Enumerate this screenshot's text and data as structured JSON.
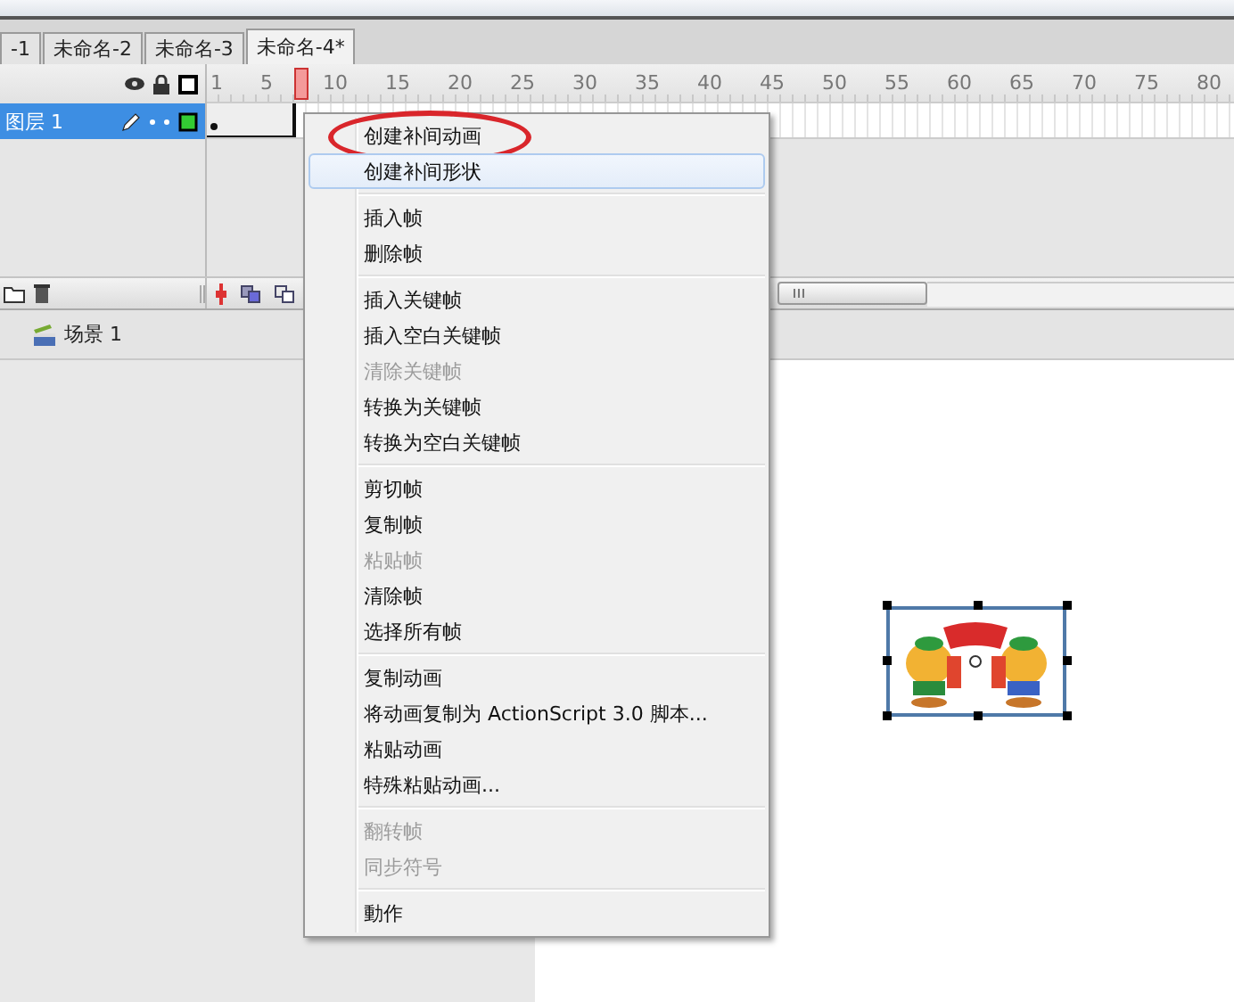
{
  "document_tabs": [
    {
      "label": "-1",
      "selected": false
    },
    {
      "label": "未命名-2",
      "selected": false
    },
    {
      "label": "未命名-3",
      "selected": false
    },
    {
      "label": "未命名-4*",
      "selected": true
    }
  ],
  "timeline": {
    "ruler_labels": [
      "1",
      "5",
      "10",
      "15",
      "20",
      "25",
      "30",
      "35",
      "40",
      "45",
      "50",
      "55",
      "60",
      "65",
      "70",
      "75",
      "80"
    ],
    "playhead": {
      "level": 0.085
    },
    "layers": [
      {
        "name": "图层 1",
        "selected": true,
        "color": "#33cc33"
      }
    ]
  },
  "scene_bar": {
    "scene": "场景 1"
  },
  "stage": {
    "object": {
      "kind": "picture",
      "selected": true
    }
  },
  "context_menu": {
    "groups": [
      {
        "items": [
          {
            "label": "创建补间动画",
            "disabled": false,
            "highlighted": false,
            "circled": true
          },
          {
            "label": "创建补间形状",
            "disabled": false,
            "highlighted": true,
            "circled": false
          }
        ]
      },
      {
        "items": [
          {
            "label": "插入帧",
            "disabled": false,
            "highlighted": false,
            "circled": false
          },
          {
            "label": "删除帧",
            "disabled": false,
            "highlighted": false,
            "circled": false
          }
        ]
      },
      {
        "items": [
          {
            "label": "插入关键帧",
            "disabled": false,
            "highlighted": false,
            "circled": false
          },
          {
            "label": "插入空白关键帧",
            "disabled": false,
            "highlighted": false,
            "circled": false
          },
          {
            "label": "清除关键帧",
            "disabled": true,
            "highlighted": false,
            "circled": false
          },
          {
            "label": "转换为关键帧",
            "disabled": false,
            "highlighted": false,
            "circled": false
          },
          {
            "label": "转换为空白关键帧",
            "disabled": false,
            "highlighted": false,
            "circled": false
          }
        ]
      },
      {
        "items": [
          {
            "label": "剪切帧",
            "disabled": false,
            "highlighted": false,
            "circled": false
          },
          {
            "label": "复制帧",
            "disabled": false,
            "highlighted": false,
            "circled": false
          },
          {
            "label": "粘贴帧",
            "disabled": true,
            "highlighted": false,
            "circled": false
          },
          {
            "label": "清除帧",
            "disabled": false,
            "highlighted": false,
            "circled": false
          },
          {
            "label": "选择所有帧",
            "disabled": false,
            "highlighted": false,
            "circled": false
          }
        ]
      },
      {
        "items": [
          {
            "label": "复制动画",
            "disabled": false,
            "highlighted": false,
            "circled": false
          },
          {
            "label": "将动画复制为 ActionScript 3.0 脚本...",
            "disabled": false,
            "highlighted": false,
            "circled": false
          },
          {
            "label": "粘贴动画",
            "disabled": false,
            "highlighted": false,
            "circled": false
          },
          {
            "label": "特殊粘贴动画...",
            "disabled": false,
            "highlighted": false,
            "circled": false
          }
        ]
      },
      {
        "items": [
          {
            "label": "翻转帧",
            "disabled": true,
            "highlighted": false,
            "circled": false
          },
          {
            "label": "同步符号",
            "disabled": true,
            "highlighted": false,
            "circled": false
          }
        ]
      },
      {
        "items": [
          {
            "label": "動作",
            "disabled": false,
            "highlighted": false,
            "circled": false
          }
        ]
      }
    ]
  }
}
